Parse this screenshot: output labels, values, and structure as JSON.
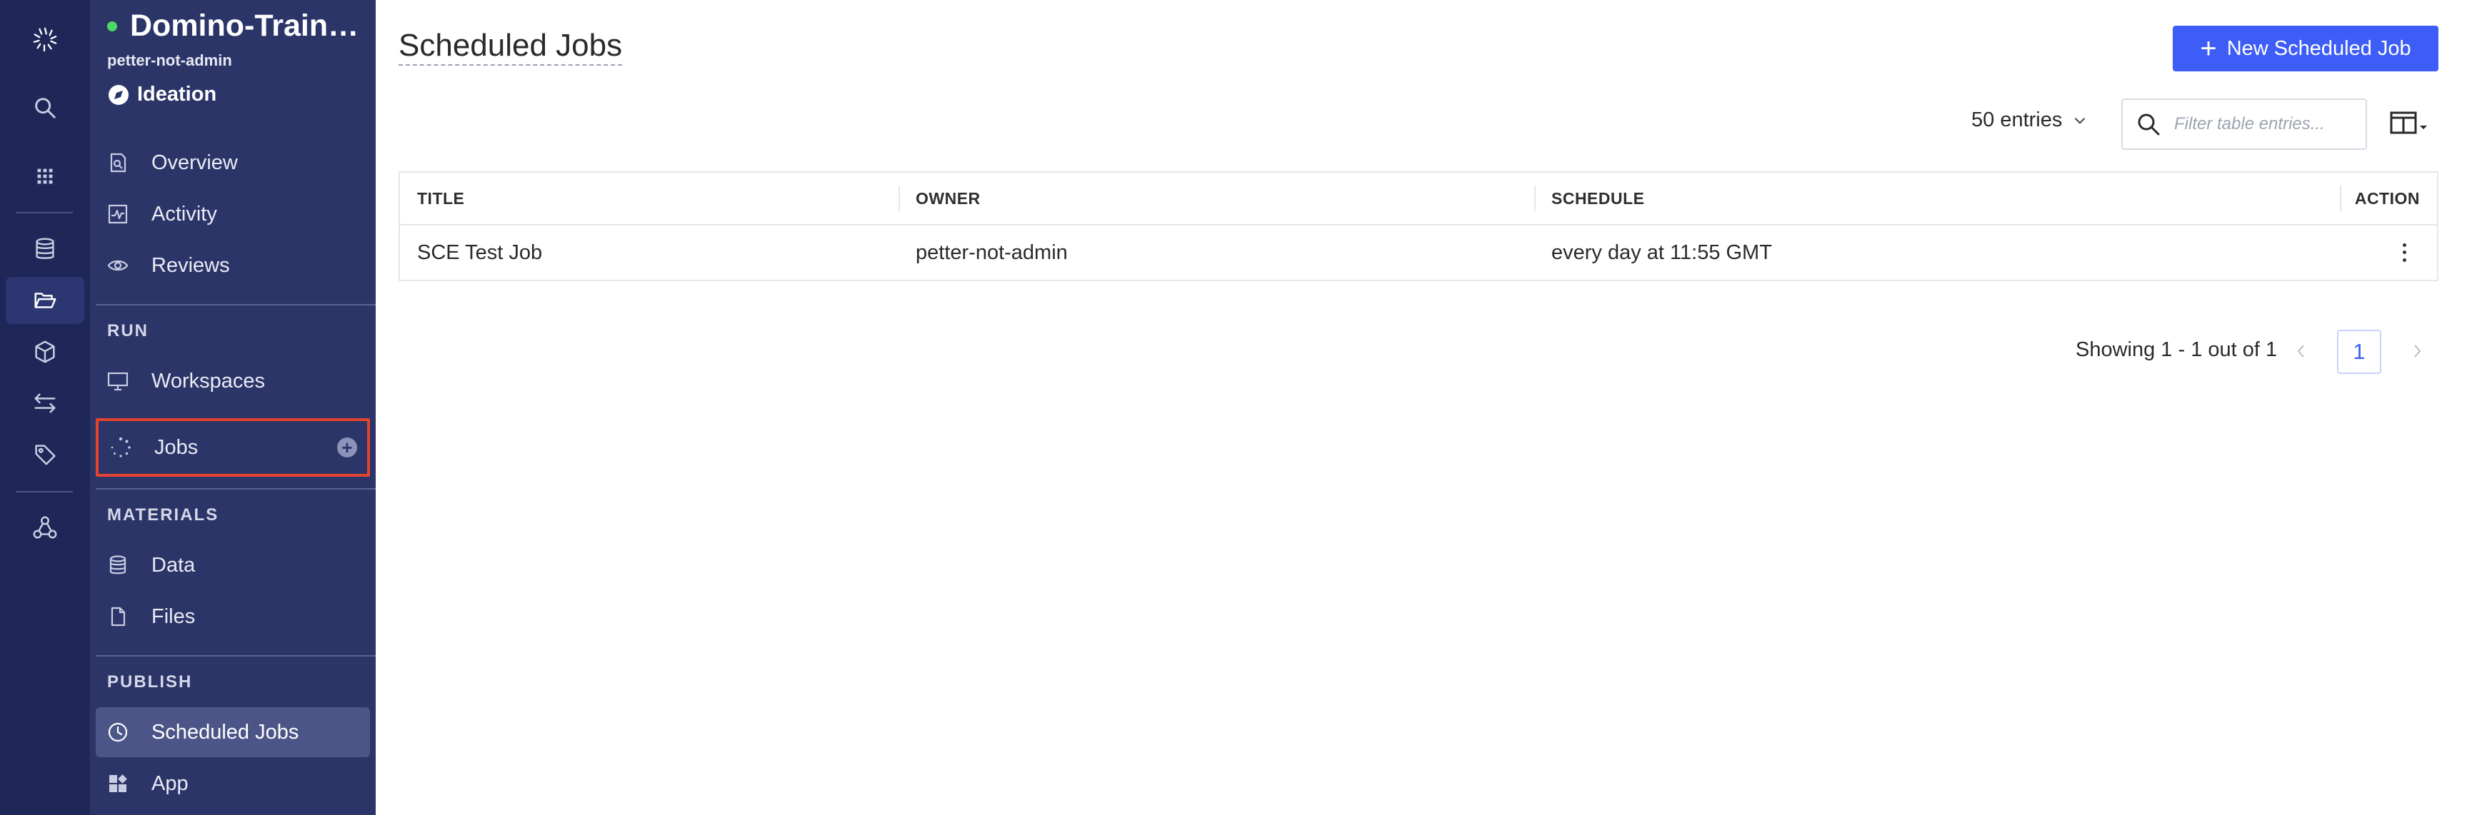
{
  "rail": {
    "icons": [
      "domino-logo-icon",
      "search-icon",
      "apps-grid-icon",
      "database-icon",
      "folder-open-icon",
      "cube-icon",
      "transfer-arrows-icon",
      "tag-icon",
      "network-icon"
    ]
  },
  "project": {
    "name": "Domino-Train…",
    "owner": "petter-not-admin",
    "stage": "Ideation"
  },
  "sidebar": {
    "top_items": [
      {
        "label": "Overview",
        "icon": "overview-icon"
      },
      {
        "label": "Activity",
        "icon": "activity-icon"
      },
      {
        "label": "Reviews",
        "icon": "eye-icon"
      }
    ],
    "run": {
      "heading": "RUN",
      "items": [
        {
          "label": "Workspaces",
          "icon": "monitor-icon"
        },
        {
          "label": "Jobs",
          "icon": "spinner-icon",
          "add_icon": "plus-circle-icon",
          "highlighted": true
        }
      ]
    },
    "materials": {
      "heading": "MATERIALS",
      "items": [
        {
          "label": "Data",
          "icon": "database-icon"
        },
        {
          "label": "Files",
          "icon": "file-icon"
        }
      ]
    },
    "publish": {
      "heading": "PUBLISH",
      "items": [
        {
          "label": "Scheduled Jobs",
          "icon": "clock-icon",
          "active": true
        },
        {
          "label": "App",
          "icon": "app-icon"
        }
      ]
    }
  },
  "main": {
    "title": "Scheduled Jobs",
    "new_button_label": "New Scheduled Job",
    "entries_label": "50 entries",
    "filter_placeholder": "Filter table entries...",
    "table": {
      "columns": [
        "TITLE",
        "OWNER",
        "SCHEDULE",
        "ACTION"
      ],
      "rows": [
        {
          "title": "SCE Test Job",
          "owner": "petter-not-admin",
          "schedule": "every day at 11:55 GMT"
        }
      ]
    },
    "pagination": {
      "showing": "Showing 1 - 1 out of 1",
      "current_page": "1"
    }
  },
  "colors": {
    "rail_bg": "#1e2757",
    "sidebar_bg": "#2b3568",
    "accent": "#3d5df6",
    "highlight_border": "#e5432e",
    "online": "#4cd964"
  }
}
